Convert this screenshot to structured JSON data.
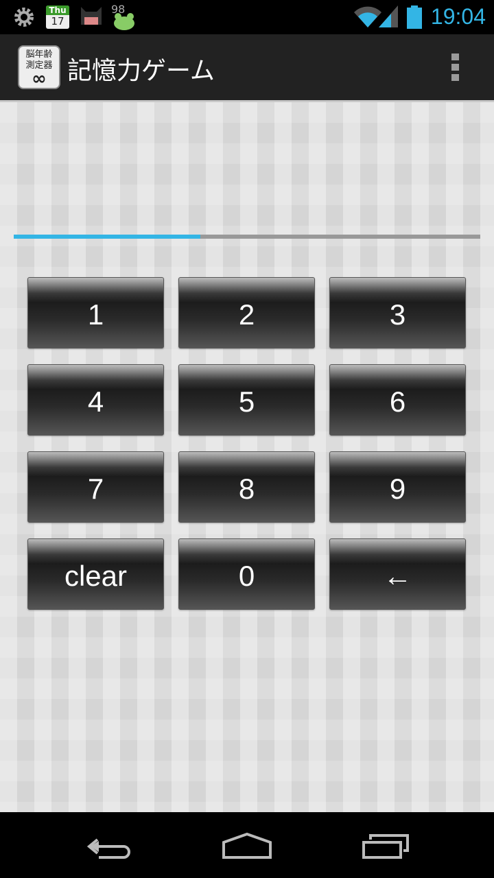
{
  "status_bar": {
    "time": "19:04",
    "calendar_day": "Thu",
    "calendar_date": "17",
    "notification_count": "98",
    "icons": [
      "settings-icon",
      "calendar-icon",
      "cat-icon",
      "frog-icon",
      "wifi-icon",
      "signal-icon",
      "battery-icon"
    ]
  },
  "action_bar": {
    "app_icon_line1": "脳年齢",
    "app_icon_line2": "測定器",
    "app_icon_symbol": "∞",
    "title": "記憶力ゲーム"
  },
  "progress": {
    "value": 0.4,
    "color": "#33b5e5"
  },
  "keypad": {
    "keys": [
      "1",
      "2",
      "3",
      "4",
      "5",
      "6",
      "7",
      "8",
      "9",
      "clear",
      "0",
      "←"
    ]
  },
  "nav_bar": {
    "icons": [
      "back-icon",
      "home-icon",
      "recent-apps-icon"
    ]
  }
}
